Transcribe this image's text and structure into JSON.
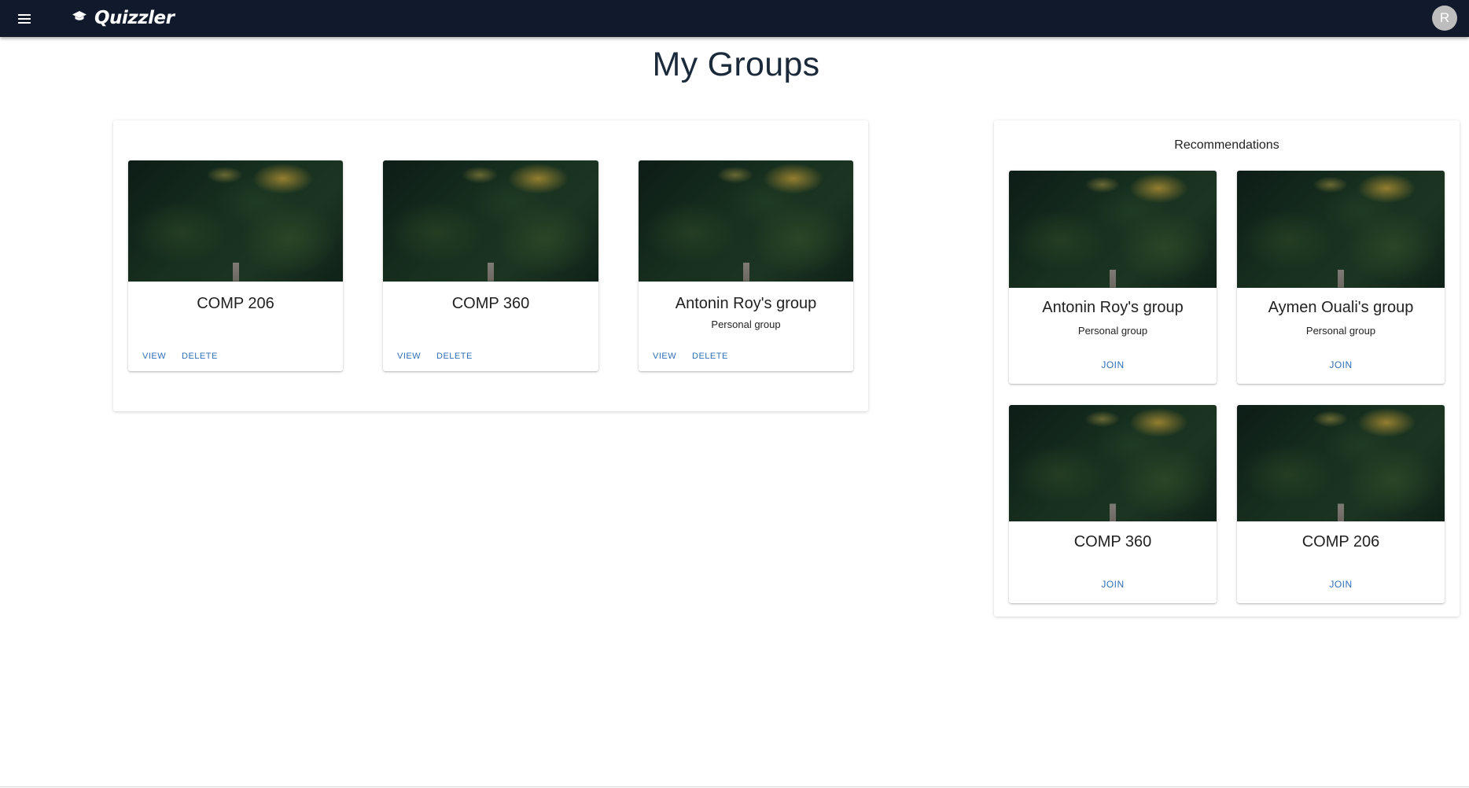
{
  "app": {
    "brand": "Quizzler",
    "avatar_initial": "R",
    "colors": {
      "topbar": "#111a2d",
      "link": "#2f6fb7"
    }
  },
  "header": {
    "menu_icon": "menu-icon",
    "brand_icon": "graduation-cap-icon"
  },
  "page": {
    "title": "My Groups"
  },
  "my_groups": [
    {
      "title": "COMP 206",
      "subtitle": "",
      "view_label": "VIEW",
      "delete_label": "DELETE"
    },
    {
      "title": "COMP 360",
      "subtitle": "",
      "view_label": "VIEW",
      "delete_label": "DELETE"
    },
    {
      "title": "Antonin Roy's group",
      "subtitle": "Personal group",
      "view_label": "VIEW",
      "delete_label": "DELETE"
    }
  ],
  "recommendations": {
    "title": "Recommendations",
    "items": [
      {
        "title": "Antonin Roy's group",
        "subtitle": "Personal group",
        "join_label": "JOIN"
      },
      {
        "title": "Aymen Ouali's group",
        "subtitle": "Personal group",
        "join_label": "JOIN"
      },
      {
        "title": "COMP 360",
        "subtitle": "",
        "join_label": "JOIN"
      },
      {
        "title": "COMP 206",
        "subtitle": "",
        "join_label": "JOIN"
      }
    ]
  }
}
